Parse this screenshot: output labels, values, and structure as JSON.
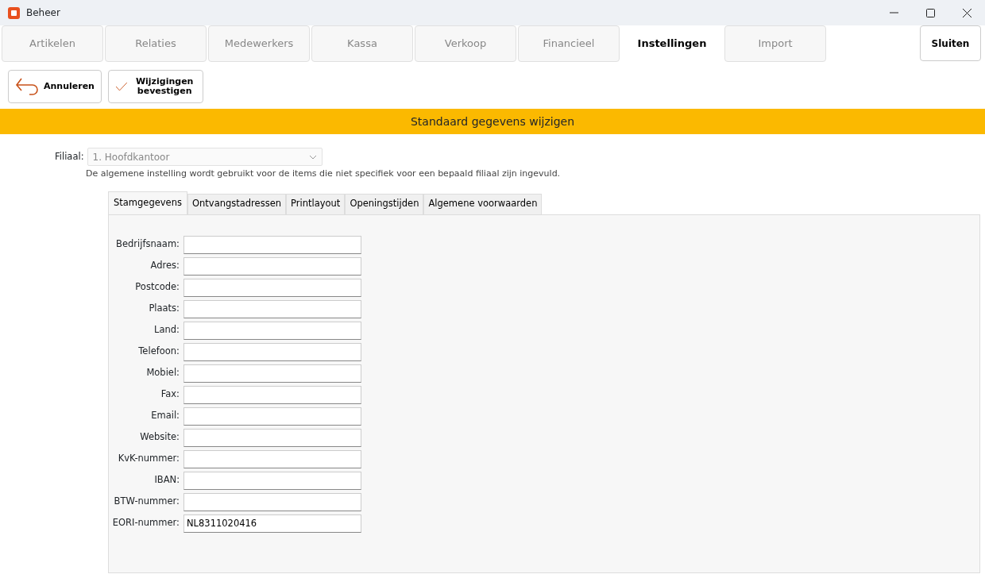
{
  "window": {
    "title": "Beheer"
  },
  "module_tabs": [
    {
      "label": "Artikelen",
      "selected": false
    },
    {
      "label": "Relaties",
      "selected": false
    },
    {
      "label": "Medewerkers",
      "selected": false
    },
    {
      "label": "Kassa",
      "selected": false
    },
    {
      "label": "Verkoop",
      "selected": false
    },
    {
      "label": "Financieel",
      "selected": false
    },
    {
      "label": "Instellingen",
      "selected": true
    },
    {
      "label": "Import",
      "selected": false
    }
  ],
  "close_button": "Sluiten",
  "toolbar": [
    {
      "kind": "cancel",
      "label": "Annuleren"
    },
    {
      "kind": "confirm",
      "label": "Wijzigingen bevestigen"
    }
  ],
  "banner": "Standaard gegevens wijzigen",
  "branch": {
    "label": "Filiaal:",
    "value": "1. Hoofdkantoor",
    "disabled": true,
    "note": "De algemene instelling wordt gebruikt voor de items die niet specifiek voor een bepaald filiaal zijn ingevuld."
  },
  "tabs": [
    {
      "label": "Stamgegevens",
      "selected": true
    },
    {
      "label": "Ontvangstadressen",
      "selected": false
    },
    {
      "label": "Printlayout",
      "selected": false
    },
    {
      "label": "Openingstijden",
      "selected": false
    },
    {
      "label": "Algemene voorwaarden",
      "selected": false
    }
  ],
  "fields": [
    {
      "label": "Bedrijfsnaam:"
    },
    {
      "label": "Adres:"
    },
    {
      "label": "Postcode:"
    },
    {
      "label": "Plaats:"
    },
    {
      "label": "Land:"
    },
    {
      "label": "Telefoon:"
    },
    {
      "label": "Mobiel:"
    },
    {
      "label": "Fax:"
    },
    {
      "label": "Email:"
    },
    {
      "label": "Website:"
    },
    {
      "label": "KvK-nummer:"
    },
    {
      "label": "IBAN:"
    },
    {
      "label": "BTW-nummer:"
    },
    {
      "label": "EORI-nummer:",
      "value": "NL8311020416"
    }
  ]
}
